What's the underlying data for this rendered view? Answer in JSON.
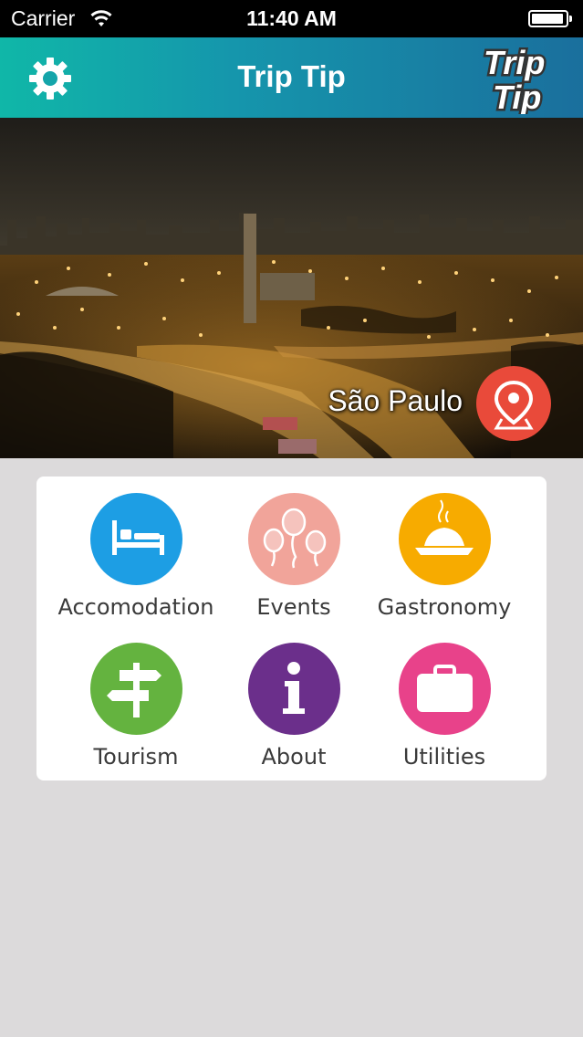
{
  "status_bar": {
    "carrier": "Carrier",
    "time": "11:40 AM",
    "battery_level": 0.95
  },
  "nav": {
    "title": "Trip Tip",
    "logo_line1": "Trip",
    "logo_line2": "Tip"
  },
  "hero": {
    "city": "São Paulo"
  },
  "menu": {
    "accomodation": {
      "label": "Accomodation",
      "color": "#1d9ee4",
      "icon": "bed-icon"
    },
    "events": {
      "label": "Events",
      "color": "#f1a49a",
      "icon": "balloons-icon"
    },
    "gastronomy": {
      "label": "Gastronomy",
      "color": "#f7ab00",
      "icon": "dish-icon"
    },
    "tourism": {
      "label": "Tourism",
      "color": "#64b33f",
      "icon": "signpost-icon"
    },
    "about": {
      "label": "About",
      "color": "#6b2f8b",
      "icon": "info-icon"
    },
    "utilities": {
      "label": "Utilities",
      "color": "#e8428a",
      "icon": "suitcase-icon"
    }
  },
  "colors": {
    "nav_start": "#10b7a8",
    "nav_end": "#1a6f9d",
    "pin": "#e94a3a",
    "background": "#dcdadb"
  }
}
